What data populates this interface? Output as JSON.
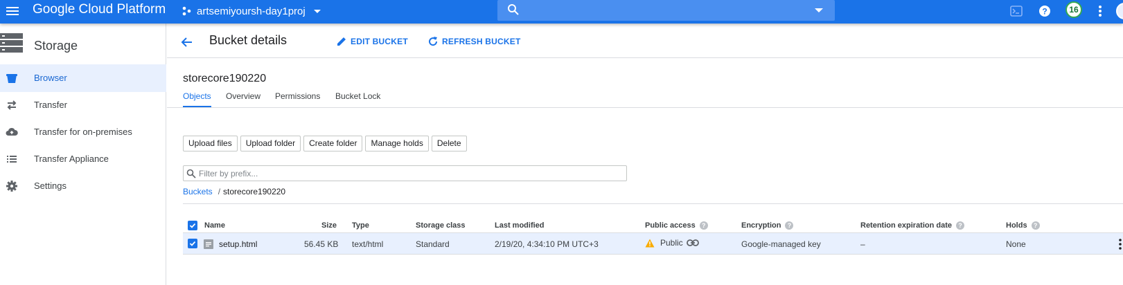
{
  "topbar": {
    "brand": "Google Cloud Platform",
    "project": "artsemiyoursh-day1proj",
    "search_placeholder": "",
    "notification_count": "16"
  },
  "sidebar": {
    "title": "Storage",
    "items": [
      {
        "label": "Browser",
        "icon": "bucket-icon",
        "active": true
      },
      {
        "label": "Transfer",
        "icon": "transfer-icon"
      },
      {
        "label": "Transfer for on-premises",
        "icon": "cloud-upload-icon"
      },
      {
        "label": "Transfer Appliance",
        "icon": "list-icon"
      },
      {
        "label": "Settings",
        "icon": "gear-icon"
      }
    ]
  },
  "header": {
    "title": "Bucket details",
    "edit_label": "EDIT BUCKET",
    "refresh_label": "REFRESH BUCKET"
  },
  "bucket": {
    "name": "storecore190220",
    "tabs": [
      "Objects",
      "Overview",
      "Permissions",
      "Bucket Lock"
    ],
    "active_tab": "Objects"
  },
  "actions": [
    "Upload files",
    "Upload folder",
    "Create folder",
    "Manage holds",
    "Delete"
  ],
  "filter": {
    "placeholder": "Filter by prefix..."
  },
  "breadcrumb": {
    "root": "Buckets",
    "separator": "/",
    "current": "storecore190220"
  },
  "table": {
    "headers": {
      "name": "Name",
      "size": "Size",
      "type": "Type",
      "storage_class": "Storage class",
      "last_modified": "Last modified",
      "public_access": "Public access",
      "encryption": "Encryption",
      "retention": "Retention expiration date",
      "holds": "Holds"
    },
    "rows": [
      {
        "name": "setup.html",
        "size": "56.45 KB",
        "type": "text/html",
        "storage_class": "Standard",
        "last_modified": "2/19/20, 4:34:10 PM UTC+3",
        "public_access": "Public",
        "encryption": "Google-managed key",
        "retention": "–",
        "holds": "None"
      }
    ]
  },
  "colors": {
    "topbar": "#1a73e8",
    "accent": "#1a73e8",
    "selected_row": "#e8f0fe",
    "warning": "#f9ab00",
    "badge_ring": "#34a853"
  }
}
